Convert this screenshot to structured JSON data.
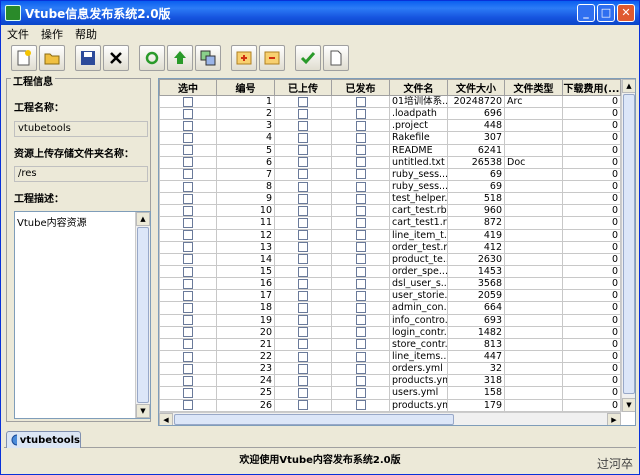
{
  "window": {
    "title": "Vtube信息发布系统2.0版"
  },
  "menu": [
    "文件",
    "操作",
    "帮助"
  ],
  "toolbar": [
    "new-icon",
    "open-icon",
    "save-icon",
    "close-icon",
    "refresh-icon",
    "upload-icon",
    "copy-icon",
    "add-icon",
    "remove-icon",
    "publish-icon",
    "document-icon"
  ],
  "project": {
    "group_title": "工程信息",
    "name_label": "工程名称：",
    "name_value": "vtubetools",
    "folder_label": "资源上传存储文件夹名称：",
    "folder_value": "/res",
    "desc_label": "工程描述：",
    "desc_value": "Vtube内容资源"
  },
  "table": {
    "headers": [
      "选中",
      "编号",
      "已上传",
      "已发布",
      "文件名",
      "文件大小",
      "文件类型",
      "下载费用(..."
    ],
    "rows": [
      [
        "1",
        "01培训体系...",
        "20248720",
        "Arc",
        "0"
      ],
      [
        "2",
        ".loadpath",
        "696",
        "",
        "0"
      ],
      [
        "3",
        ".project",
        "448",
        "",
        "0"
      ],
      [
        "4",
        "Rakefile",
        "307",
        "",
        "0"
      ],
      [
        "5",
        "README",
        "6241",
        "",
        "0"
      ],
      [
        "6",
        "untitled.txt",
        "26538",
        "Doc",
        "0"
      ],
      [
        "7",
        "ruby_sess...",
        "69",
        "",
        "0"
      ],
      [
        "8",
        "ruby_sess...",
        "69",
        "",
        "0"
      ],
      [
        "9",
        "test_helper...",
        "518",
        "",
        "0"
      ],
      [
        "10",
        "cart_test.rb",
        "960",
        "",
        "0"
      ],
      [
        "11",
        "cart_test1.rb",
        "872",
        "",
        "0"
      ],
      [
        "12",
        "line_item_t...",
        "419",
        "",
        "0"
      ],
      [
        "13",
        "order_test.rb",
        "412",
        "",
        "0"
      ],
      [
        "14",
        "product_te...",
        "2630",
        "",
        "0"
      ],
      [
        "15",
        "order_spe...",
        "1453",
        "",
        "0"
      ],
      [
        "16",
        "dsl_user_s...",
        "3568",
        "",
        "0"
      ],
      [
        "17",
        "user_storie...",
        "2059",
        "",
        "0"
      ],
      [
        "18",
        "admin_con...",
        "664",
        "",
        "0"
      ],
      [
        "19",
        "info_contro...",
        "693",
        "",
        "0"
      ],
      [
        "20",
        "login_contr...",
        "1482",
        "",
        "0"
      ],
      [
        "21",
        "store_contr...",
        "813",
        "",
        "0"
      ],
      [
        "22",
        "line_items....",
        "447",
        "",
        "0"
      ],
      [
        "23",
        "orders.yml",
        "32",
        "",
        "0"
      ],
      [
        "24",
        "products.yml",
        "318",
        "",
        "0"
      ],
      [
        "25",
        "users.yml",
        "158",
        "",
        "0"
      ],
      [
        "26",
        "products.yml",
        "179",
        "",
        "0"
      ]
    ]
  },
  "tab": {
    "label": "vtubetools"
  },
  "status": {
    "text": "欢迎使用Vtube内容发布系统2.0版"
  },
  "watermark": "过河卒"
}
